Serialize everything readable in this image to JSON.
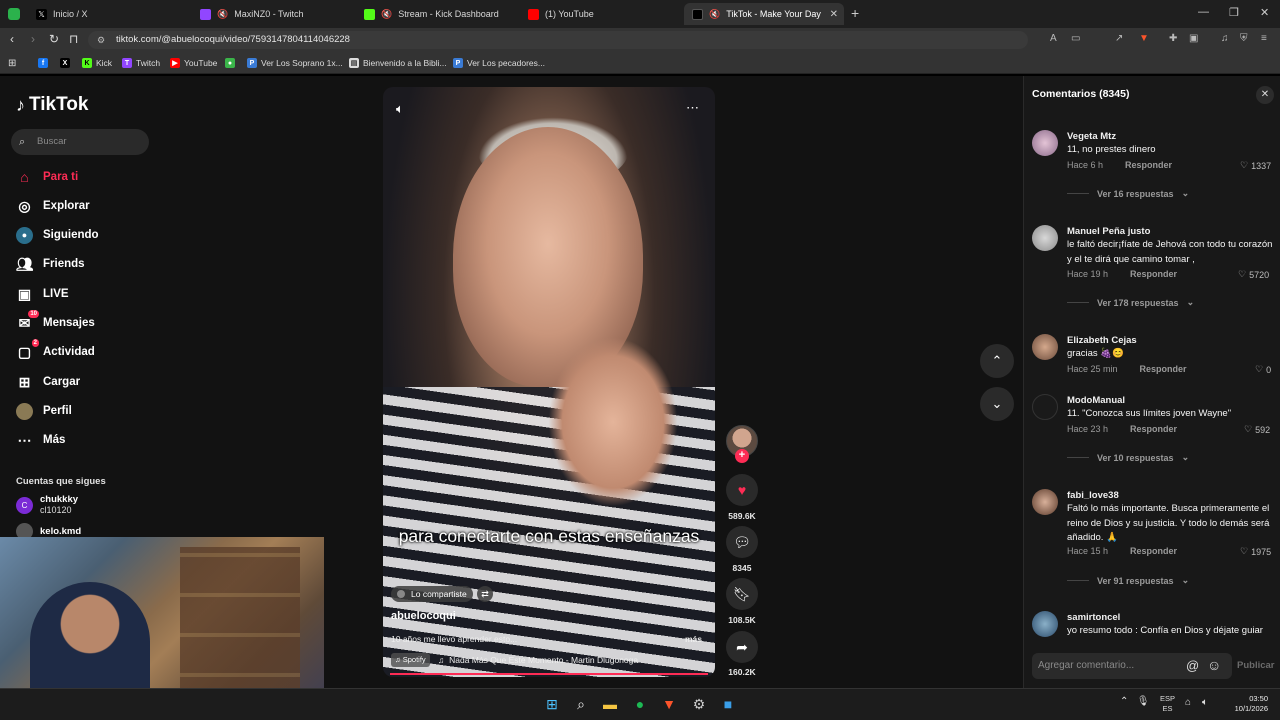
{
  "browser": {
    "tabs": [
      {
        "label": "Inicio / X",
        "favicon": "x-icon",
        "color": "#000000"
      },
      {
        "label": "MaxiNZ0 - Twitch",
        "favicon": "twitch-icon",
        "color": "#9146ff"
      },
      {
        "label": "Stream - Kick Dashboard",
        "favicon": "kick-icon",
        "color": "#53fc18"
      },
      {
        "label": "(1) YouTube",
        "favicon": "youtube-icon",
        "color": "#ff0000"
      },
      {
        "label": "TikTok - Make Your Day",
        "favicon": "tiktok-icon",
        "color": "#000000"
      }
    ],
    "url": "tiktok.com/@abuelocoqui/video/7593147804114046228",
    "bookmarks": [
      "Kick",
      "Twitch",
      "YouTube",
      "Ver Los Soprano 1x...",
      "Bienvenido a la Bibli...",
      "Ver Los pecadores..."
    ]
  },
  "tiktok": {
    "logo": "TikTok",
    "search_placeholder": "Buscar",
    "nav": [
      {
        "label": "Para ti",
        "icon": "home-icon"
      },
      {
        "label": "Explorar",
        "icon": "compass-icon"
      },
      {
        "label": "Siguiendo",
        "icon": "following-icon"
      },
      {
        "label": "Friends",
        "icon": "friends-icon"
      },
      {
        "label": "LIVE",
        "icon": "live-icon"
      },
      {
        "label": "Mensajes",
        "icon": "messages-icon",
        "badge": "10"
      },
      {
        "label": "Actividad",
        "icon": "activity-icon",
        "badge": "2"
      },
      {
        "label": "Cargar",
        "icon": "upload-icon"
      },
      {
        "label": "Perfil",
        "icon": "profile-icon"
      },
      {
        "label": "Más",
        "icon": "more-icon"
      }
    ],
    "following_title": "Cuentas que sigues",
    "following": [
      {
        "name": "chukkky",
        "sub": "cl10120"
      },
      {
        "name": "kelo.kmd",
        "sub": ""
      }
    ],
    "accent": "#fe2c55"
  },
  "video": {
    "caption": "para conectarte con estas enseñanzas",
    "shared_label": "Lo compartiste",
    "username": "abuelocoqui",
    "description": "10 años me llevo aprender esto... ",
    "more": "más",
    "spotify": "Spotify",
    "music": "Nada Más Que Este Momento - Martin Dlugonoga",
    "likes": "589.6K",
    "comments": "8345",
    "saves": "108.5K",
    "shares": "160.2K"
  },
  "comments_panel": {
    "title": "Comentarios (8345)",
    "input_placeholder": "Agregar comentario...",
    "publish": "Publicar",
    "reply_label": "Responder",
    "items": [
      {
        "user": "Vegeta Mtz",
        "text": "11, no prestes dinero",
        "time": "Hace 6 h",
        "likes": "1337",
        "more": "Ver 16 respuestas"
      },
      {
        "user": "Manuel Peña justo",
        "text": "le faltó decir¡fíate de Jehová con todo tu corazón y el te dirá que camino tomar ,",
        "time": "Hace 19 h",
        "likes": "5720",
        "more": "Ver 178 respuestas"
      },
      {
        "user": "Elizabeth Cejas",
        "text": "gracias 🍇😊",
        "time": "Hace 25 min",
        "likes": "0",
        "more": ""
      },
      {
        "user": "ModoManual",
        "text": "11. \"Conozca sus límites joven Wayne\"",
        "time": "Hace 23 h",
        "likes": "592",
        "more": "Ver 10 respuestas"
      },
      {
        "user": "fabi_love38",
        "text": "Faltó lo más importante. Busca primeramente el reino de Dios y su justicia. Y todo lo demás será añadido. 🙏",
        "time": "Hace 15 h",
        "likes": "1975",
        "more": "Ver 91 respuestas"
      },
      {
        "user": "samirtoncel",
        "text": "yo resumo todo : Confía en Dios y déjate guiar",
        "time": "",
        "likes": "",
        "more": ""
      }
    ]
  },
  "taskbar": {
    "lang": "ESP",
    "lang2": "ES",
    "time": "03:50",
    "date": "10/1/2026"
  }
}
